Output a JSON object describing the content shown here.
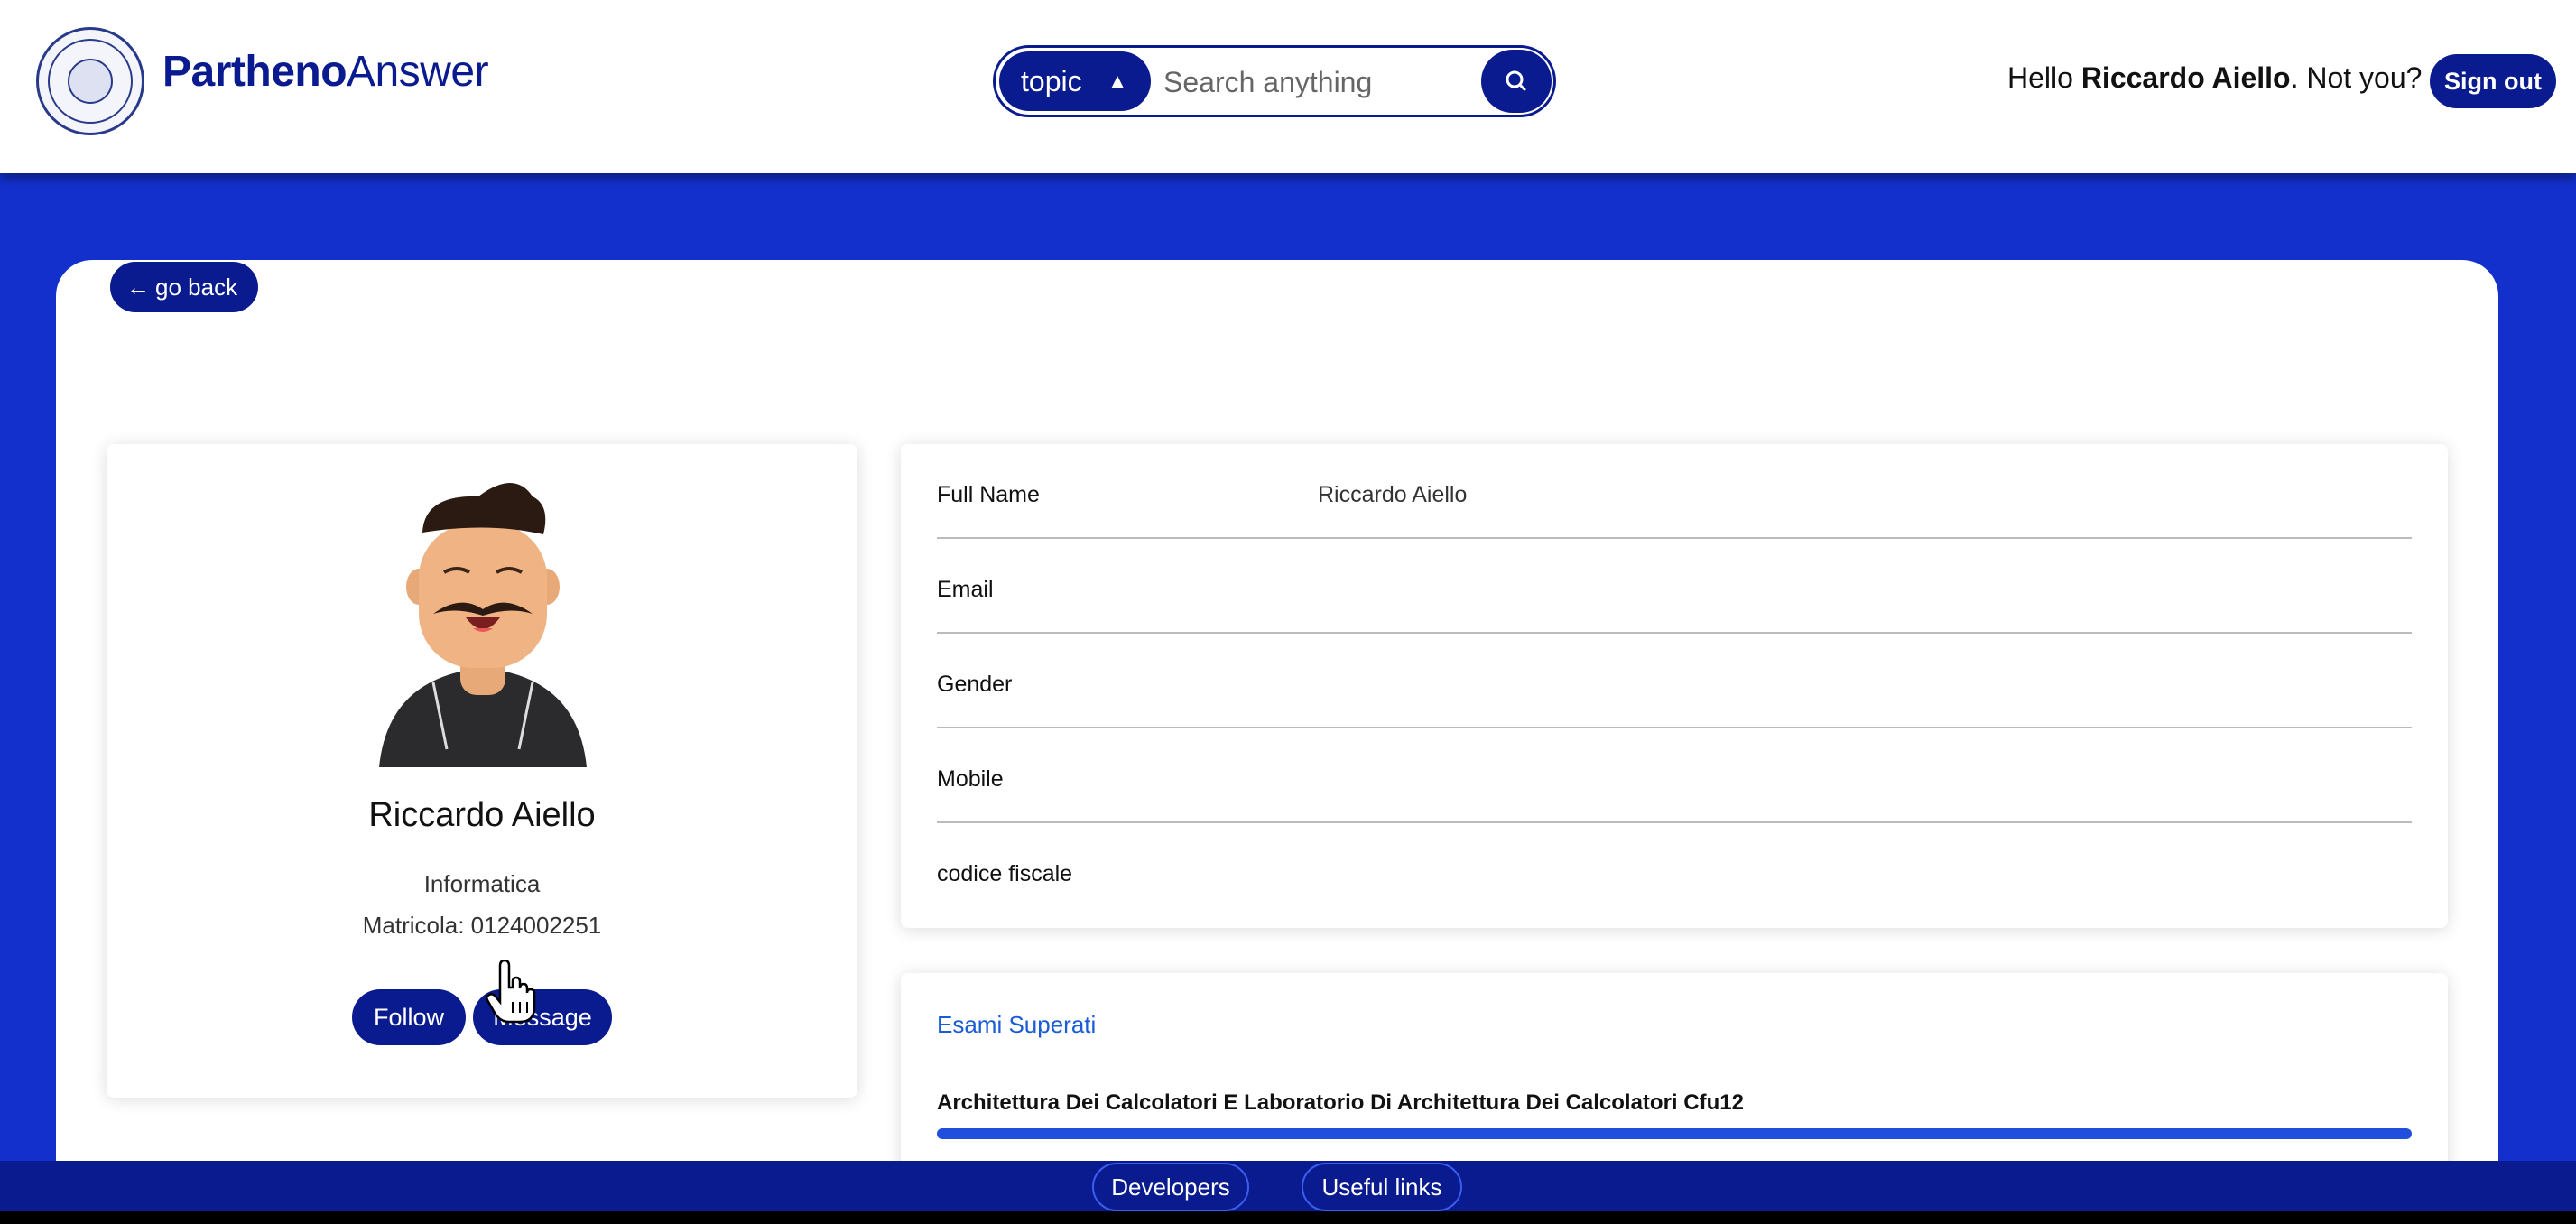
{
  "header": {
    "brand_bold": "Partheno",
    "brand_regular": "Answer",
    "search": {
      "topic_label": "topic",
      "placeholder": "Search anything"
    },
    "hello_prefix": "Hello ",
    "user_name": "Riccardo Aiello",
    "hello_suffix": ". Not you?",
    "sign_out_label": "Sign out"
  },
  "nav": {
    "go_back_arrow": "←",
    "go_back_label": "go back"
  },
  "profile": {
    "name": "Riccardo Aiello",
    "department": "Informatica",
    "matricola": "Matricola: 0124002251",
    "follow_label": "Follow",
    "message_label": "Message"
  },
  "details": {
    "rows": [
      {
        "label": "Full Name",
        "value": "Riccardo Aiello"
      },
      {
        "label": "Email",
        "value": ""
      },
      {
        "label": "Gender",
        "value": ""
      },
      {
        "label": "Mobile",
        "value": ""
      },
      {
        "label": "codice fiscale",
        "value": ""
      }
    ]
  },
  "exams": {
    "title": "Esami Superati",
    "items": [
      {
        "name": "Architettura Dei Calcolatori E Laboratorio Di Architettura Dei Calcolatori Cfu12",
        "progress": 1.0
      }
    ]
  },
  "footer": {
    "developers_label": "Developers",
    "useful_links_label": "Useful links"
  },
  "icons": {
    "search": "search-icon",
    "arrow_left": "arrow-left-icon",
    "sort": "sort-updown-icon",
    "cursor": "hand-pointer-icon"
  },
  "colors": {
    "brand_navy": "#0a1a8f",
    "background_blue": "#1330cc",
    "link_blue": "#1a5cd6",
    "progress_blue": "#1f4fdc"
  }
}
